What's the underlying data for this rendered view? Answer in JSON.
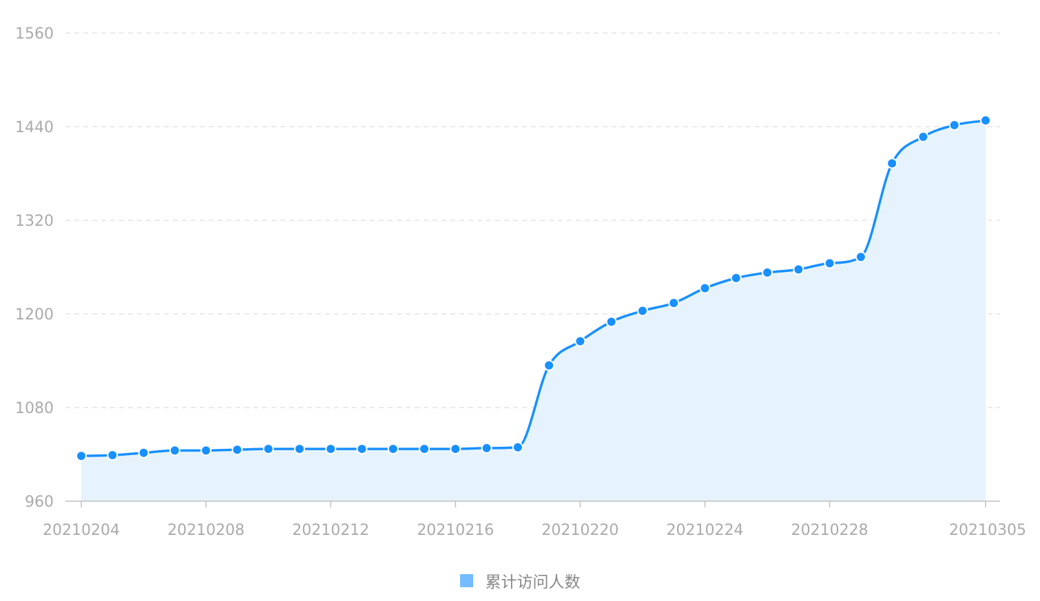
{
  "chart_data": {
    "type": "area",
    "title": "",
    "xlabel": "",
    "ylabel": "",
    "ylim": [
      960,
      1560
    ],
    "y_ticks": [
      "960",
      "1080",
      "1200",
      "1320",
      "1440",
      "1560"
    ],
    "x_tick_labels": [
      "20210204",
      "20210208",
      "20210212",
      "20210216",
      "20210220",
      "20210224",
      "20210228",
      "20210305"
    ],
    "grid": true,
    "line_color": "#1890ff",
    "fill_color": "#e6f3fd",
    "legend_position": "bottom-center",
    "x": [
      "20210204",
      "20210205",
      "20210206",
      "20210207",
      "20210208",
      "20210209",
      "20210210",
      "20210211",
      "20210212",
      "20210213",
      "20210214",
      "20210215",
      "20210216",
      "20210217",
      "20210218",
      "20210219",
      "20210220",
      "20210221",
      "20210222",
      "20210223",
      "20210224",
      "20210225",
      "20210226",
      "20210227",
      "20210228",
      "20210301",
      "20210302",
      "20210303",
      "20210304",
      "20210305"
    ],
    "series": [
      {
        "name": "累计访问人数",
        "color": "#1890ff",
        "legend_color": "#74bcff",
        "values": [
          1018,
          1019,
          1022,
          1025,
          1025,
          1026,
          1027,
          1027,
          1027,
          1027,
          1027,
          1027,
          1027,
          1028,
          1029,
          1134,
          1165,
          1190,
          1204,
          1214,
          1233,
          1246,
          1253,
          1257,
          1265,
          1273,
          1393,
          1427,
          1442,
          1448
        ]
      }
    ]
  },
  "legend": {
    "label": "累计访问人数"
  }
}
